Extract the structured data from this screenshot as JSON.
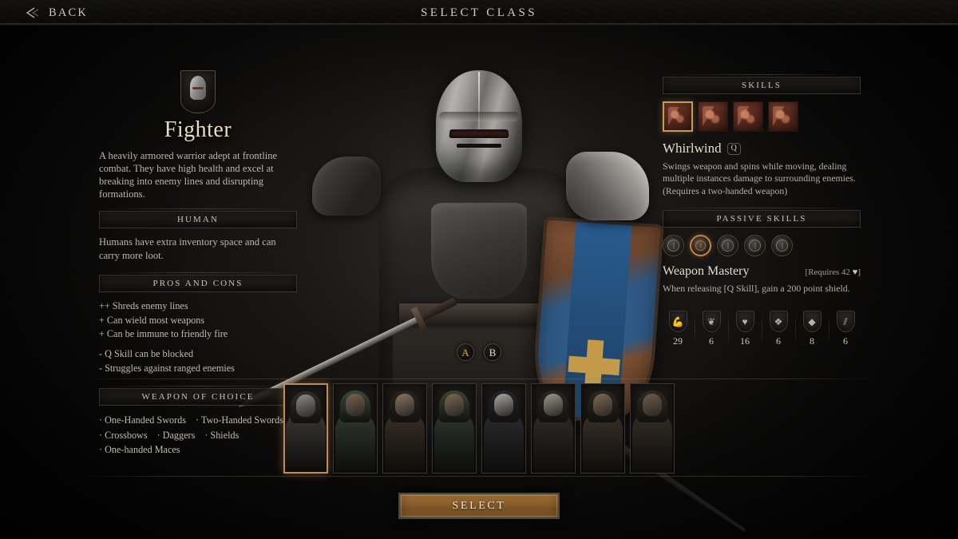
{
  "topbar": {
    "back_label": "BACK",
    "back_icon": "chevron-left-icon",
    "title": "SELECT CLASS"
  },
  "class": {
    "emblem_icon": "shield-helmet-emblem-icon",
    "name": "Fighter",
    "description": "A heavily armored warrior adept at frontline combat. They have high health and excel at breaking into enemy lines and disrupting formations.",
    "race_header": "HUMAN",
    "race_description": "Humans have extra inventory space and can carry more loot.",
    "proscons_header": "PROS AND CONS",
    "pros": [
      "++ Shreds enemy lines",
      "+ Can wield most weapons",
      "+ Can be immune to friendly fire"
    ],
    "cons": [
      "- Q Skill can be blocked",
      "- Struggles against ranged enemies"
    ],
    "weapon_header": "WEAPON OF CHOICE",
    "weapons_rows": [
      [
        "· One-Handed Swords",
        "· Two-Handed Swords"
      ],
      [
        "· Crossbows",
        "· Daggers",
        "· Shields"
      ],
      [
        "· One-handed Maces"
      ]
    ]
  },
  "markers": [
    {
      "name": "marker-a",
      "label": "A",
      "color": "#d89a46"
    },
    {
      "name": "marker-b",
      "label": "B",
      "color": "#ddd8cf"
    }
  ],
  "skills": {
    "header": "SKILLS",
    "icons": [
      {
        "name": "whirlwind-skill-icon",
        "selected": true
      },
      {
        "name": "war-cry-skill-icon",
        "selected": false
      },
      {
        "name": "charge-skill-icon",
        "selected": false
      },
      {
        "name": "cleave-skill-icon",
        "selected": false
      }
    ],
    "selected": {
      "name": "Whirlwind",
      "key": "Q",
      "description": "Swings weapon and spins while moving, dealing multiple instances damage to surrounding enemies. (Requires a two-handed weapon)"
    }
  },
  "passives": {
    "header": "PASSIVE SKILLS",
    "icons": [
      {
        "name": "shield-passive-icon",
        "selected": false
      },
      {
        "name": "weapon-mastery-passive-icon",
        "selected": true
      },
      {
        "name": "sword-passive-icon",
        "selected": false
      },
      {
        "name": "beast-passive-icon",
        "selected": false
      },
      {
        "name": "arm-passive-icon",
        "selected": false
      }
    ],
    "selected": {
      "name": "Weapon Mastery",
      "requires_prefix": "[Requires ",
      "requires_value": "42",
      "requires_icon": "♥",
      "requires_suffix": "]",
      "description": "When releasing [Q Skill], gain a 200 point shield."
    }
  },
  "stats": [
    {
      "name": "strength-stat",
      "icon": "💪",
      "value": "29"
    },
    {
      "name": "agility-stat",
      "icon": "❦",
      "value": "6"
    },
    {
      "name": "vitality-stat",
      "icon": "♥",
      "value": "16"
    },
    {
      "name": "knowledge-stat",
      "icon": "❖",
      "value": "6"
    },
    {
      "name": "armor-stat",
      "icon": "◆",
      "value": "8"
    },
    {
      "name": "resist-stat",
      "icon": "⫽",
      "value": "6"
    }
  ],
  "roster": [
    {
      "name": "class-portrait-fighter",
      "selected": true,
      "body": "#3a3936",
      "head": "#8e8c87",
      "hood": "#2f2e2b"
    },
    {
      "name": "class-portrait-cleric",
      "selected": false,
      "body": "#30392f",
      "head": "#7a6450",
      "hood": "#3b4a38"
    },
    {
      "name": "class-portrait-barbarian",
      "selected": false,
      "body": "#3a2f24",
      "head": "#8a7560",
      "hood": "#2a231c"
    },
    {
      "name": "class-portrait-ranger",
      "selected": false,
      "body": "#2c362c",
      "head": "#7d6853",
      "hood": "#39472f"
    },
    {
      "name": "class-portrait-wizard",
      "selected": false,
      "body": "#2a2b2e",
      "head": "#a9a79f",
      "hood": "#23242a"
    },
    {
      "name": "class-portrait-warlock",
      "selected": false,
      "body": "#2d2c28",
      "head": "#9b988e",
      "hood": "#272621"
    },
    {
      "name": "class-portrait-rogue",
      "selected": false,
      "body": "#3a3128",
      "head": "#7f6a55",
      "hood": "#2b2620"
    },
    {
      "name": "class-portrait-bard",
      "selected": false,
      "body": "#352e26",
      "head": "#6f5c49",
      "hood": "#302922"
    }
  ],
  "footer": {
    "select_label": "SELECT"
  },
  "colors": {
    "accent_gold": "#c08a50",
    "title_cream": "#e8dcc0",
    "panel_text": "#bdb7ac",
    "background": "#090909"
  }
}
